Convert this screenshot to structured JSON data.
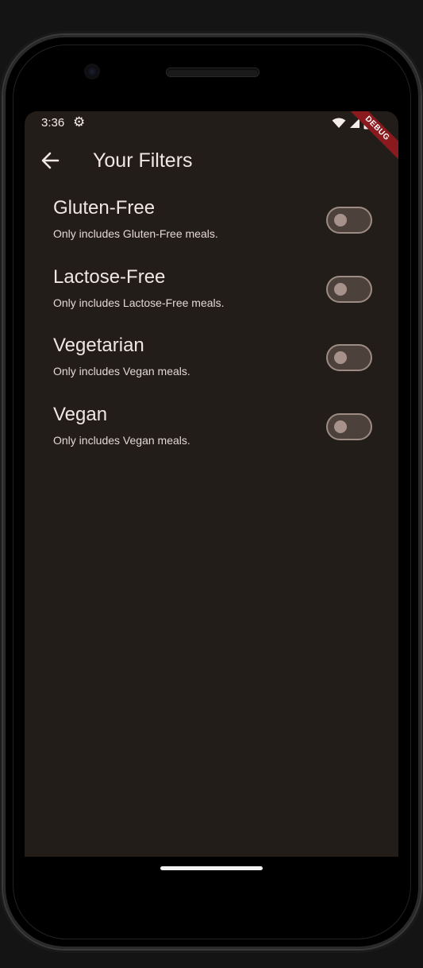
{
  "status_bar": {
    "time": "3:36",
    "icons": [
      "gear-icon",
      "wifi-icon",
      "signal-icon",
      "battery-icon"
    ],
    "debug_label": "DEBUG"
  },
  "app_bar": {
    "title": "Your Filters",
    "back_icon": "arrow-left-icon"
  },
  "filters": [
    {
      "title": "Gluten-Free",
      "subtitle": "Only includes Gluten-Free meals.",
      "enabled": false
    },
    {
      "title": "Lactose-Free",
      "subtitle": "Only includes Lactose-Free meals.",
      "enabled": false
    },
    {
      "title": "Vegetarian",
      "subtitle": "Only includes Vegan meals.",
      "enabled": false
    },
    {
      "title": "Vegan",
      "subtitle": "Only includes Vegan meals.",
      "enabled": false
    }
  ],
  "colors": {
    "background": "#231d19",
    "text": "#ece0da",
    "switch_track_off": "#4d413b",
    "switch_border_off": "#9c8c84",
    "switch_knob_off": "#a6928a",
    "debug_banner": "#8b1a1f"
  }
}
